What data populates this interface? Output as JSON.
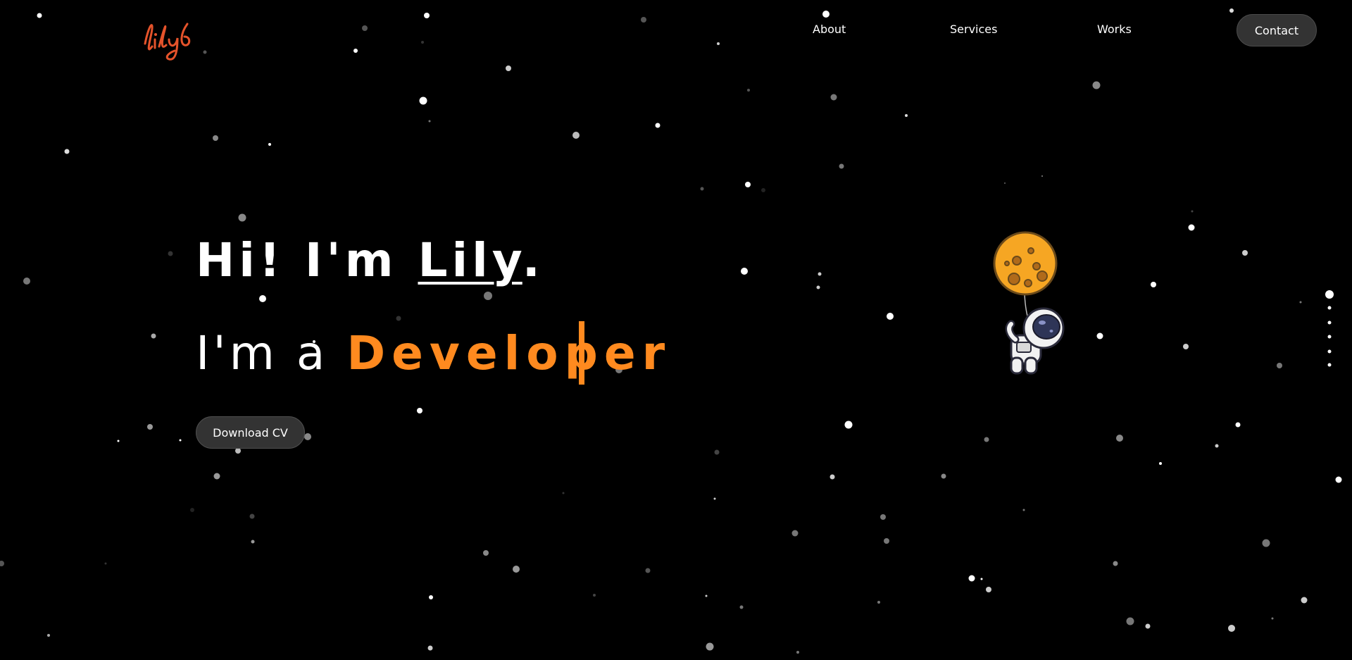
{
  "logo": {
    "text": "lily",
    "color": "#e5532b"
  },
  "nav": {
    "items": [
      {
        "label": "About"
      },
      {
        "label": "Services"
      },
      {
        "label": "Works"
      }
    ],
    "contact_label": "Contact"
  },
  "hero": {
    "greeting_prefix": "Hi! I'm ",
    "name": "Lily",
    "greeting_suffix": ".",
    "role_prefix": "I'm a ",
    "role": "Developer",
    "download_label": "Download CV"
  },
  "colors": {
    "background": "#000000",
    "accent": "#ff8a1f",
    "logo": "#e5532b",
    "button_bg": "#333333"
  },
  "icons": {
    "logo": "lily-logo-icon",
    "astronaut": "astronaut-balloon-icon",
    "side_nav": "side-dots-icon"
  }
}
